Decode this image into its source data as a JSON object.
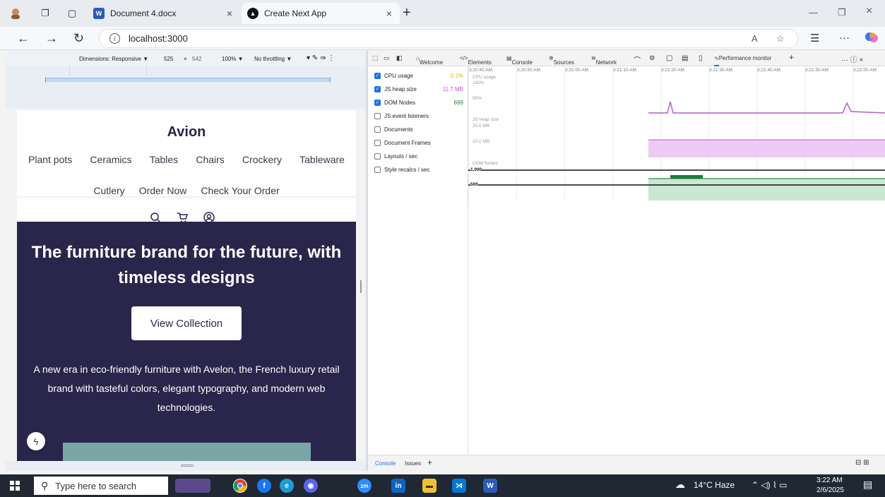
{
  "browser": {
    "tabs": [
      {
        "title": "Document 4.docx",
        "icon": "word-icon",
        "active": false
      },
      {
        "title": "Create Next App",
        "icon": "nextjs-icon",
        "active": true
      }
    ],
    "address": "localhost:3000"
  },
  "device_toolbar": {
    "dimensions": "Dimensions: Responsive ▼",
    "width": "525",
    "times": "×",
    "height": "542",
    "zoom": "100% ▼",
    "throttling": "No throttling ▼"
  },
  "site": {
    "brand": "Avion",
    "nav_row1": [
      "Plant pots",
      "Ceramics",
      "Tables",
      "Chairs",
      "Crockery",
      "Tableware"
    ],
    "nav_row2": [
      "Cutlery",
      "Order Now",
      "Check Your Order"
    ],
    "hero_title": "The furniture brand for the future, with timeless designs",
    "hero_button": "View Collection",
    "hero_text": "A new era in eco-friendly furniture with Avelon, the French luxury retail brand with tasteful colors, elegant typography, and modern web technologies."
  },
  "devtools": {
    "tabs": [
      "Welcome",
      "Elements",
      "Console",
      "Sources",
      "Network",
      "Performance monitor"
    ],
    "metrics": [
      {
        "label": "CPU usage",
        "checked": true,
        "value": "0.1%",
        "color": "#f2a900"
      },
      {
        "label": "JS heap size",
        "checked": true,
        "value": "11.7 MB",
        "color": "#c54fd6"
      },
      {
        "label": "DOM Nodes",
        "checked": true,
        "value": "699",
        "color": "#1e7b3e"
      },
      {
        "label": "JS event listeners",
        "checked": false,
        "value": ""
      },
      {
        "label": "Documents",
        "checked": false,
        "value": ""
      },
      {
        "label": "Document Frames",
        "checked": false,
        "value": ""
      },
      {
        "label": "Layouts / sec",
        "checked": false,
        "value": ""
      },
      {
        "label": "Style recalcs / sec",
        "checked": false,
        "value": ""
      }
    ],
    "times": [
      "3:20:40 AM",
      "3:20:50 AM",
      "3:21:00 AM",
      "3:21:10 AM",
      "3:21:20 AM",
      "3:21:30 AM",
      "3:21:40 AM",
      "3:21:50 AM",
      "3:22:00 AM"
    ],
    "graph_labels": {
      "cpu": "CPU usage",
      "cpu_100": "100%",
      "cpu_50": "50%",
      "heap": "JS heap size",
      "heap_20": "20.0 MB",
      "heap_10": "10.0 MB",
      "dom": "DOM Nodes",
      "dom_1000": "1,000",
      "dom_500": "500"
    },
    "drawer_tabs": [
      "Console",
      "Issues"
    ]
  },
  "taskbar": {
    "search_placeholder": "Type here to search",
    "weather": "14°C  Haze",
    "time": "3:22 AM",
    "date": "2/6/2025"
  }
}
